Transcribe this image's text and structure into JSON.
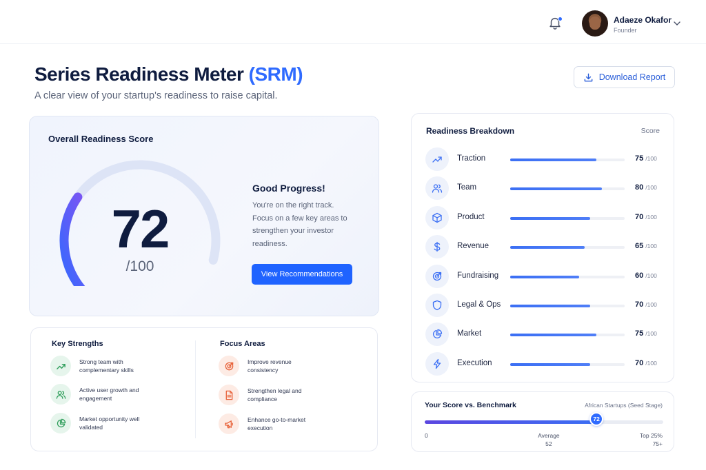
{
  "header": {
    "user_name": "Adaeze Okafor",
    "user_role": "Founder",
    "icons": [
      "bell-icon",
      "chevron-down-icon"
    ]
  },
  "page": {
    "title": "Series Readiness Meter",
    "title_accent": "(SRM)",
    "subtitle": "A clear view of your startup's readiness to raise capital.",
    "download_label": "Download Report"
  },
  "score": {
    "title": "Overall Readiness Score",
    "value": "72",
    "max": "/100",
    "fraction": 0.72,
    "status_title": "Good Progress!",
    "status_text": "You're on the right track. Focus on a few key areas to strengthen your investor readiness.",
    "button_label": "View Recommendations"
  },
  "strengths": {
    "title": "Key Strengths",
    "items": [
      {
        "icon": "trend-up-icon",
        "text": "Strong team with complementary skills"
      },
      {
        "icon": "users-icon",
        "text": "Active user growth and engagement"
      },
      {
        "icon": "pie-chart-icon",
        "text": "Market opportunity well validated"
      }
    ]
  },
  "focus": {
    "title": "Focus Areas",
    "items": [
      {
        "icon": "target-icon",
        "text": "Improve revenue consistency"
      },
      {
        "icon": "document-icon",
        "text": "Strengthen legal and compliance"
      },
      {
        "icon": "megaphone-icon",
        "text": "Enhance go-to-market execution"
      }
    ]
  },
  "breakdown": {
    "title": "Readiness Breakdown",
    "score_label": "Score",
    "max_label": "/100",
    "items": [
      {
        "label": "Traction",
        "value": "75",
        "icon": "trend-up-icon"
      },
      {
        "label": "Team",
        "value": "80",
        "icon": "users-icon"
      },
      {
        "label": "Product",
        "value": "70",
        "icon": "cube-icon"
      },
      {
        "label": "Revenue",
        "value": "65",
        "icon": "dollar-icon"
      },
      {
        "label": "Fundraising",
        "value": "60",
        "icon": "target-icon"
      },
      {
        "label": "Legal & Ops",
        "value": "70",
        "icon": "shield-icon"
      },
      {
        "label": "Market",
        "value": "75",
        "icon": "pie-chart-icon"
      },
      {
        "label": "Execution",
        "value": "70",
        "icon": "bolt-icon"
      }
    ]
  },
  "benchmark": {
    "title": "Your Score vs. Benchmark",
    "context": "African Startups (Seed Stage)",
    "score": "72",
    "min_label": "0",
    "average_label": "Average",
    "average_value": "52",
    "top_label": "Top 25%",
    "top_value": "75+",
    "score_fraction": 0.72,
    "average_fraction": 0.52
  },
  "colors": {
    "accent": "#2f6bff",
    "gauge_start": "#2f6bff",
    "gauge_end": "#8f4ff0",
    "strength_bg": "#e6f5ec",
    "strength_fg": "#2f9e5b",
    "focus_bg": "#fdebe4",
    "focus_fg": "#e8643c"
  }
}
